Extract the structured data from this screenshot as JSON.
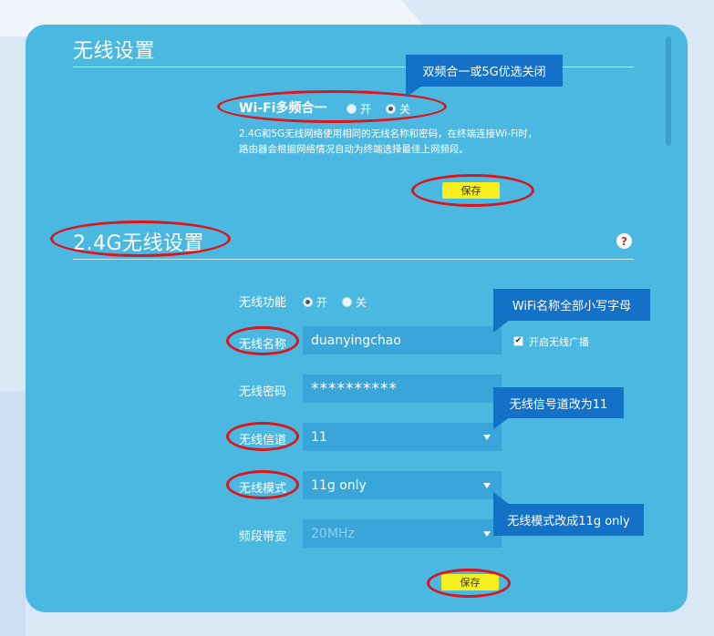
{
  "section1": {
    "title": "无线设置",
    "multiband_label": "Wi-Fi多频合一",
    "opt_on": "开",
    "opt_off": "关",
    "desc_line1": "2.4G和5G无线网络使用相同的无线名称和密码，在终端连接Wi-Fi时，",
    "desc_line2": "路由器会根据网络情况自动为终端选择最佳上网频段。",
    "save_label": "保存",
    "callout": "双频合一或5G优选关闭"
  },
  "section2": {
    "title": "2.4G无线设置",
    "help_glyph": "?",
    "wireless_func_label": "无线功能",
    "func_on": "开",
    "func_off": "关",
    "ssid_label": "无线名称",
    "ssid_value": "duanyingchao",
    "broadcast_label": "开启无线广播",
    "broadcast_check": "✔",
    "password_label": "无线密码",
    "password_value": "**********",
    "channel_label": "无线信道",
    "channel_value": "11",
    "mode_label": "无线模式",
    "mode_value": "11g only",
    "bandwidth_label": "频段带宽",
    "bandwidth_value": "20MHz",
    "save_label": "保存",
    "callout_ssid": "WiFi名称全部小写字母",
    "callout_channel": "无线信号道改为11",
    "callout_mode": "无线模式改成11g only"
  },
  "colors": {
    "card": "#4ab8e0",
    "field": "#3aa5d9",
    "save": "#f7ee1d",
    "highlight": "#d9161d",
    "callout": "#1471c8"
  }
}
